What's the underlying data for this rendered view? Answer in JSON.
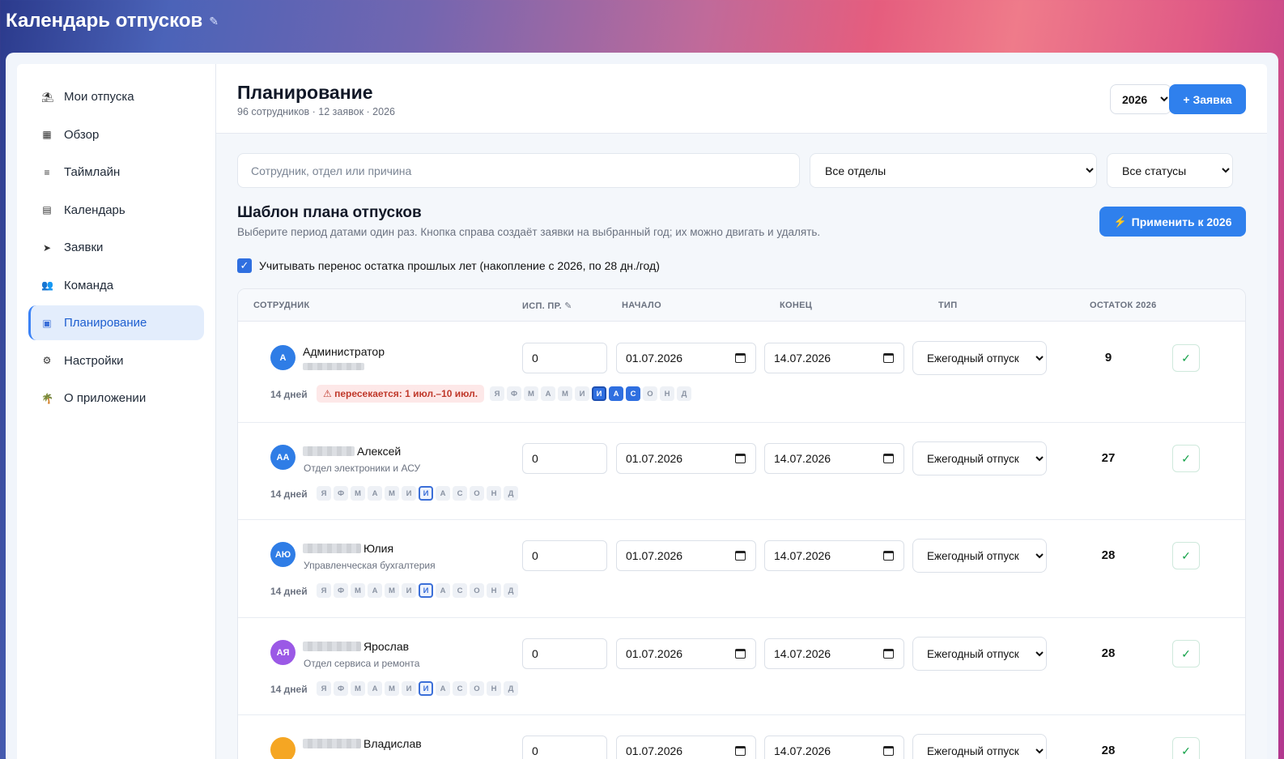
{
  "app": {
    "title": "Календарь отпусков",
    "pin_icon": "pin-icon"
  },
  "sidebar": {
    "items": [
      {
        "label": "Мои отпуска",
        "icon": "umbrella-icon",
        "glyph": "⛱"
      },
      {
        "label": "Обзор",
        "icon": "grid-icon",
        "glyph": "▦"
      },
      {
        "label": "Таймлайн",
        "icon": "lines-icon",
        "glyph": "≡"
      },
      {
        "label": "Календарь",
        "icon": "calendar-icon",
        "glyph": "▤"
      },
      {
        "label": "Заявки",
        "icon": "send-icon",
        "glyph": "➤"
      },
      {
        "label": "Команда",
        "icon": "team-icon",
        "glyph": "👥"
      },
      {
        "label": "Планирование",
        "icon": "plan-icon",
        "glyph": "▣",
        "active": true
      },
      {
        "label": "Настройки",
        "icon": "gear-icon",
        "glyph": "⚙"
      },
      {
        "label": "О приложении",
        "icon": "palm-icon",
        "glyph": "🌴"
      }
    ]
  },
  "header": {
    "title": "Планирование",
    "subtitle": "96 сотрудников · 12 заявок · 2026",
    "year": "2026",
    "new_button": "+ Заявка"
  },
  "filters": {
    "search_placeholder": "Сотрудник, отдел или причина",
    "department": "Все отделы",
    "status": "Все статусы"
  },
  "template": {
    "title": "Шаблон плана отпусков",
    "subtitle": "Выберите период датами один раз. Кнопка справа создаёт заявки на выбранный год; их можно двигать и удалять.",
    "apply_button": "Применить к 2026",
    "carry_label": "Учитывать перенос остатка прошлых лет (накопление с 2026, по 28 дн./год)"
  },
  "table": {
    "columns": [
      "СОТРУДНИК",
      "ИСП. ПР. ✎",
      "НАЧАЛО",
      "КОНЕЦ",
      "ТИП",
      "ОСТАТОК 2026"
    ],
    "month_letters": [
      "Я",
      "Ф",
      "М",
      "А",
      "М",
      "И",
      "И",
      "А",
      "С",
      "О",
      "Н",
      "Д"
    ],
    "rows": [
      {
        "initials": "А",
        "color": "#2f7de6",
        "name": "Администратор",
        "dept": "",
        "days": "14 дней",
        "warning": "⚠ пересекается: 1 июл.–10 июл.",
        "used": "0",
        "start": "01.07.2026",
        "end": "14.07.2026",
        "type": "Ежегодный отпуск",
        "remain": "9",
        "on_months": [
          6,
          7,
          8
        ],
        "cur_month": 6
      },
      {
        "initials": "АА",
        "color": "#2f7de6",
        "name": "Алексей",
        "dept": "Отдел электроники и АСУ",
        "days": "14 дней",
        "warning": "",
        "used": "0",
        "start": "01.07.2026",
        "end": "14.07.2026",
        "type": "Ежегодный отпуск",
        "remain": "27",
        "on_months": [],
        "cur_month": 6
      },
      {
        "initials": "АЮ",
        "color": "#2f7de6",
        "name": "Юлия",
        "dept": "Управленческая бухгалтерия",
        "days": "14 дней",
        "warning": "",
        "used": "0",
        "start": "01.07.2026",
        "end": "14.07.2026",
        "type": "Ежегодный отпуск",
        "remain": "28",
        "on_months": [],
        "cur_month": 6
      },
      {
        "initials": "АЯ",
        "color": "#9b59e6",
        "name": "Ярослав",
        "dept": "Отдел сервиса и ремонта",
        "days": "14 дней",
        "warning": "",
        "used": "0",
        "start": "01.07.2026",
        "end": "14.07.2026",
        "type": "Ежегодный отпуск",
        "remain": "28",
        "on_months": [],
        "cur_month": 6
      },
      {
        "initials": "",
        "color": "#f5a623",
        "name": "Владислав",
        "dept": "",
        "days": "",
        "warning": "",
        "used": "0",
        "start": "01.07.2026",
        "end": "14.07.2026",
        "type": "Ежегодный отпуск",
        "remain": "28",
        "on_months": [],
        "cur_month": 6
      }
    ]
  }
}
